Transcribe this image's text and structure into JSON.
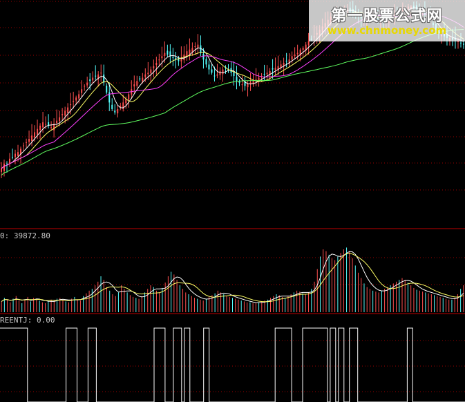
{
  "colors": {
    "background": "#000000",
    "up_bar": "#ff5050",
    "down_bar": "#54fcfc",
    "ma_white": "#ffffff",
    "ma_yellow": "#ffff66",
    "ma_magenta": "#ff40ff",
    "ma_green": "#60ff60",
    "indicator_line": "#ffffff",
    "grid": "#a00000",
    "separator": "#c00000"
  },
  "volume_panel": {
    "label": "0: 39872.80"
  },
  "indicator_panel": {
    "label": "REENTJ: 0.00"
  },
  "watermark": {
    "title": "第一股票公式网",
    "url": "www.chnmoney.com"
  },
  "chart_data": [
    {
      "type": "candlestick",
      "panel": "price",
      "n_bars": 168,
      "close": [
        0.1,
        0.13,
        0.13,
        0.16,
        0.17,
        0.19,
        0.2,
        0.22,
        0.24,
        0.26,
        0.28,
        0.3,
        0.32,
        0.34,
        0.36,
        0.38,
        0.37,
        0.36,
        0.35,
        0.37,
        0.39,
        0.41,
        0.43,
        0.45,
        0.47,
        0.49,
        0.51,
        0.53,
        0.55,
        0.58,
        0.6,
        0.62,
        0.63,
        0.65,
        0.66,
        0.67,
        0.68,
        0.62,
        0.56,
        0.5,
        0.46,
        0.44,
        0.46,
        0.48,
        0.5,
        0.52,
        0.55,
        0.58,
        0.61,
        0.63,
        0.64,
        0.65,
        0.67,
        0.68,
        0.7,
        0.72,
        0.74,
        0.76,
        0.78,
        0.8,
        0.79,
        0.78,
        0.77,
        0.76,
        0.75,
        0.77,
        0.79,
        0.81,
        0.82,
        0.83,
        0.84,
        0.85,
        0.8,
        0.76,
        0.73,
        0.7,
        0.68,
        0.66,
        0.67,
        0.69,
        0.7,
        0.71,
        0.7,
        0.68,
        0.66,
        0.63,
        0.62,
        0.61,
        0.6,
        0.61,
        0.62,
        0.63,
        0.64,
        0.65,
        0.66,
        0.67,
        0.68,
        0.69,
        0.7,
        0.71,
        0.72,
        0.73,
        0.74,
        0.75,
        0.76,
        0.78,
        0.79,
        0.8,
        0.82,
        0.83,
        0.85,
        0.87,
        0.88,
        0.9,
        0.92,
        0.94,
        0.96,
        0.98,
        1.0,
        1.02,
        1.03,
        1.04,
        1.05,
        1.06,
        1.07,
        1.06,
        1.05,
        1.04,
        1.03,
        1.02,
        1.01,
        1.0,
        1.01,
        1.02,
        1.02,
        1.01,
        1.0,
        0.99,
        0.99,
        1.0,
        1.01,
        1.02,
        1.03,
        1.04,
        1.05,
        1.06,
        1.07,
        1.08,
        1.08,
        1.07,
        1.06,
        1.05,
        1.04,
        1.03,
        1.02,
        1.0,
        0.97,
        0.94,
        0.92,
        0.91,
        0.9,
        0.89,
        0.89,
        0.88,
        0.88,
        0.87,
        0.86,
        0.85
      ],
      "moving_averages": [
        {
          "color": "#ffffff",
          "period": 5
        },
        {
          "color": "#ffff66",
          "period": 10
        },
        {
          "color": "#ff40ff",
          "period": 20
        },
        {
          "color": "#60ff60",
          "period": 60
        }
      ]
    },
    {
      "type": "bar",
      "panel": "volume",
      "values": [
        12,
        16,
        14,
        11,
        15,
        18,
        13,
        10,
        14,
        17,
        12,
        16,
        15,
        13,
        11,
        10,
        12,
        14,
        13,
        15,
        16,
        14,
        12,
        11,
        15,
        17,
        14,
        13,
        18,
        21,
        24,
        26,
        30,
        34,
        40,
        36,
        28,
        24,
        20,
        18,
        22,
        30,
        26,
        22,
        19,
        17,
        16,
        15,
        18,
        22,
        26,
        30,
        28,
        24,
        22,
        27,
        33,
        40,
        45,
        42,
        36,
        30,
        26,
        22,
        20,
        18,
        16,
        15,
        14,
        13,
        15,
        17,
        19,
        21,
        24,
        22,
        20,
        18,
        17,
        16,
        15,
        14,
        13,
        12,
        11,
        11,
        10,
        10,
        11,
        12,
        13,
        14,
        16,
        18,
        20,
        19,
        17,
        16,
        18,
        20,
        22,
        24,
        23,
        21,
        20,
        22,
        26,
        34,
        48,
        62,
        70,
        68,
        64,
        60,
        58,
        62,
        66,
        70,
        72,
        68,
        60,
        52,
        44,
        38,
        32,
        28,
        26,
        24,
        23,
        22,
        24,
        26,
        28,
        30,
        32,
        34,
        36,
        38,
        36,
        33,
        30,
        27,
        25,
        24,
        23,
        22,
        21,
        20,
        19,
        18,
        17,
        16,
        15,
        14,
        14,
        16,
        20,
        26,
        30
      ],
      "max_value": 39872.8
    },
    {
      "type": "step",
      "panel": "indicator",
      "series_name": "REENTJ",
      "values_binary": [
        1,
        1,
        1,
        1,
        1,
        1,
        1,
        1,
        1,
        1,
        0,
        0,
        0,
        0,
        0,
        0,
        0,
        0,
        0,
        0,
        0,
        0,
        0,
        0,
        1,
        1,
        1,
        1,
        0,
        0,
        0,
        0,
        1,
        1,
        1,
        0,
        0,
        0,
        0,
        0,
        0,
        0,
        0,
        0,
        0,
        0,
        0,
        0,
        0,
        0,
        0,
        0,
        0,
        0,
        0,
        0,
        1,
        1,
        1,
        1,
        0,
        0,
        0,
        1,
        1,
        1,
        0,
        1,
        1,
        0,
        0,
        0,
        0,
        0,
        1,
        1,
        0,
        0,
        0,
        0,
        0,
        0,
        0,
        0,
        0,
        0,
        0,
        0,
        0,
        0,
        0,
        0,
        0,
        0,
        0,
        0,
        0,
        0,
        0,
        0,
        1,
        1,
        1,
        1,
        1,
        1,
        0,
        0,
        0,
        0,
        1,
        1,
        1,
        1,
        1,
        1,
        1,
        1,
        1,
        0,
        1,
        1,
        0,
        1,
        1,
        0,
        0,
        1,
        1,
        1,
        0,
        0,
        0,
        0,
        0,
        0,
        0,
        0,
        0,
        0,
        0,
        0,
        0,
        0,
        0,
        0,
        0,
        0,
        1,
        1,
        0,
        0,
        0,
        0,
        0,
        0,
        0,
        0,
        0,
        0,
        0,
        0,
        0,
        0,
        0,
        0,
        0,
        0,
        0
      ]
    }
  ]
}
